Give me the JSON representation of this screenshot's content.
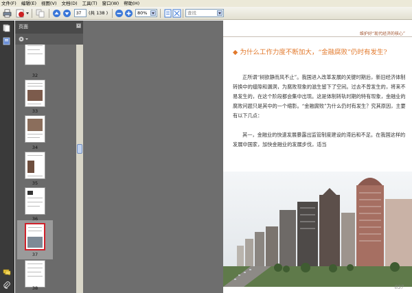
{
  "menu": [
    "文件(F)",
    "编辑(E)",
    "视图(V)",
    "文档(D)",
    "工具(T)",
    "窗口(W)",
    "帮助(H)"
  ],
  "toolbar": {
    "page_input": "37",
    "page_total": "(共 138 )",
    "zoom": "80%",
    "search_placeholder": "查找"
  },
  "sidebar": {
    "panel_title": "页面",
    "thumbnails": [
      {
        "label": "32"
      },
      {
        "label": "33"
      },
      {
        "label": "34"
      },
      {
        "label": "35"
      },
      {
        "label": "36"
      },
      {
        "label": "37",
        "selected": true
      },
      {
        "label": "38"
      }
    ]
  },
  "document": {
    "running_head": "维护好“现代经济的核心”",
    "heading": "◆ 为什么工作力度不断加大，“金融腐败”仍时有发生?",
    "paragraphs": [
      "正所谓“树欲静而风不止”。我国进入改革发展的关键时期后，新旧经济体制转换中的缝隙和漏洞，为腐败现象的滋生留下了空间。过去不曾发生的，将来不易发生的，在这个阶段都会集中出现。这是体制转轨时期的特有现象，金融业的腐败问题只是其中的一个缩影。“金融腐败”为什么仍时有发生？究其原因，主要有以下几点：",
      "其一，金融业的快速发展暴露出监管制度建设的滞后和不足。在我国这样的发展中国家，加快金融业的发展步伐，适当"
    ],
    "page_number": "037"
  },
  "colors": {
    "heading": "#e2792c",
    "panel_bg": "#6d6d6d",
    "selected_border": "#d0202a"
  }
}
